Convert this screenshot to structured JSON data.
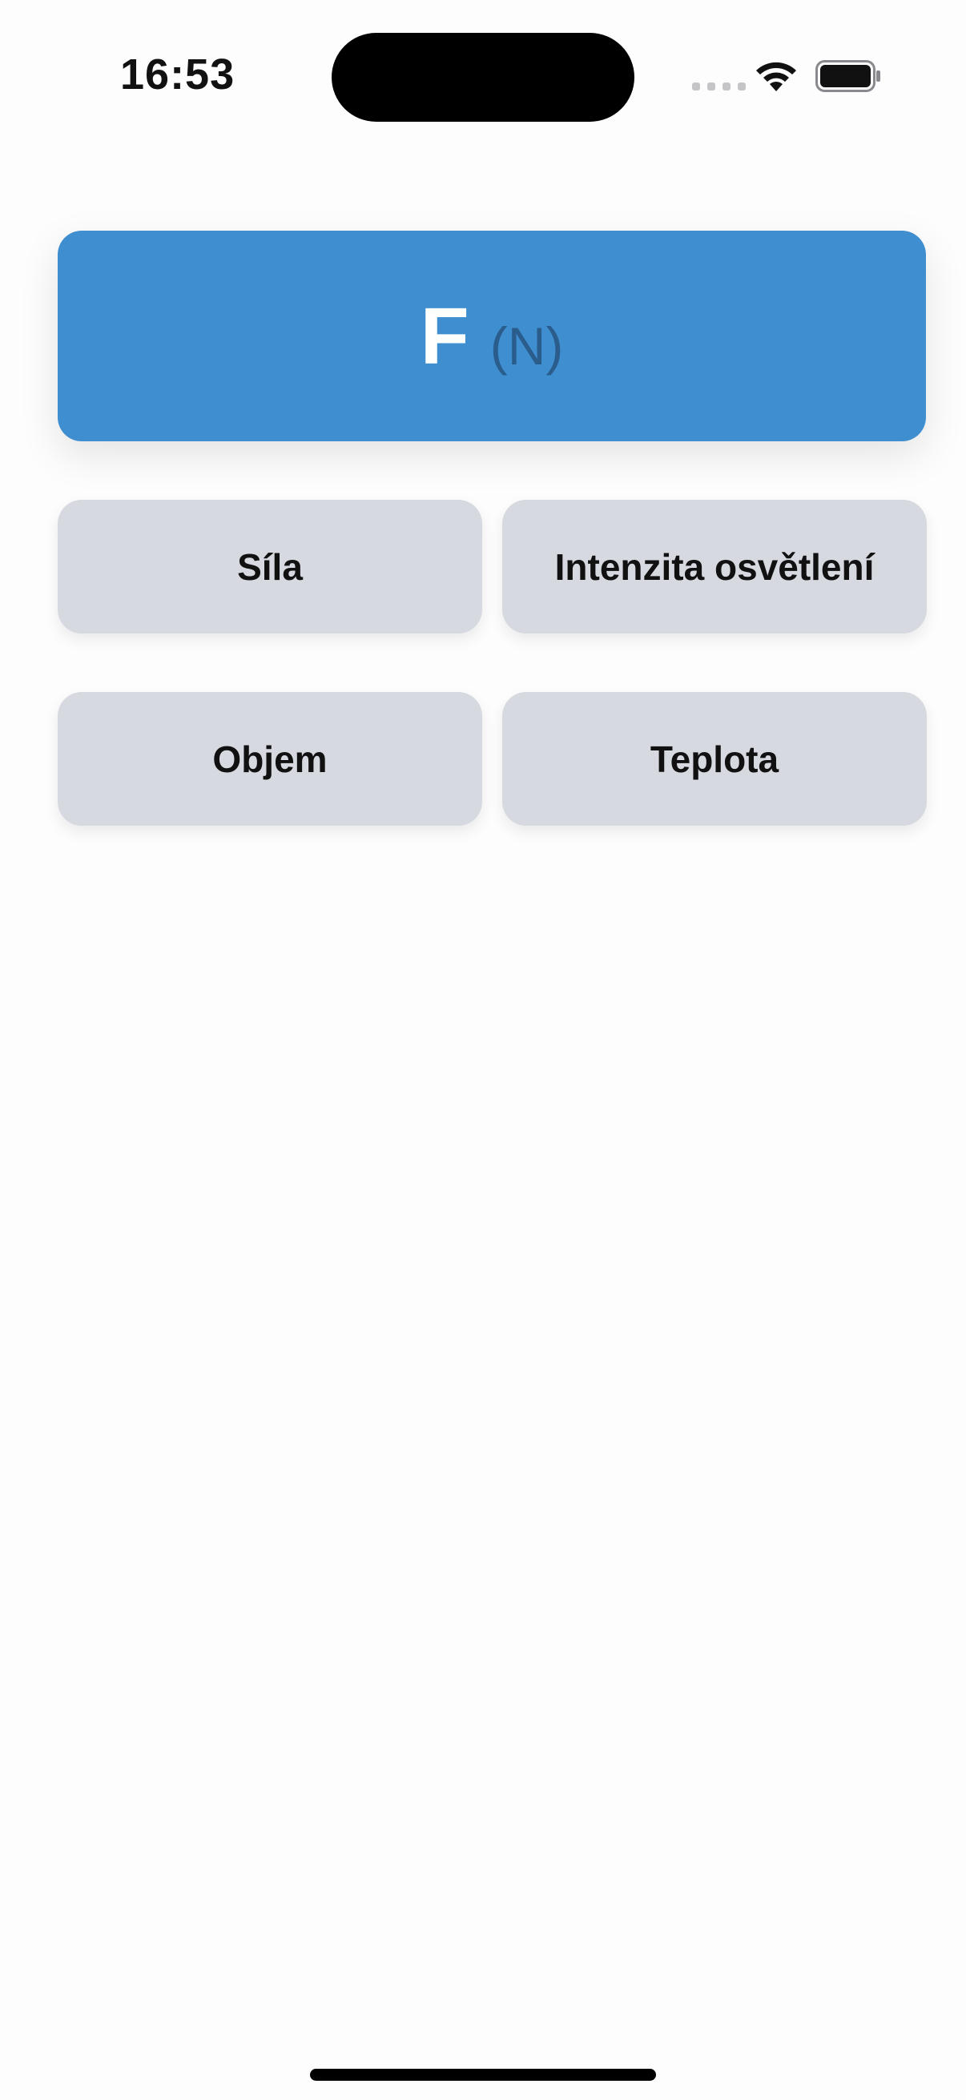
{
  "status_bar": {
    "time": "16:53"
  },
  "card": {
    "symbol": "F",
    "unit": "(N)",
    "color": "#3e8ed0"
  },
  "options": [
    {
      "label": "Síla"
    },
    {
      "label": "Intenzita osvětlení"
    },
    {
      "label": "Objem"
    },
    {
      "label": "Teplota"
    }
  ],
  "icons": {
    "wifi": "wifi-icon",
    "battery": "battery-icon",
    "signal": "cellular-signal-icon"
  }
}
